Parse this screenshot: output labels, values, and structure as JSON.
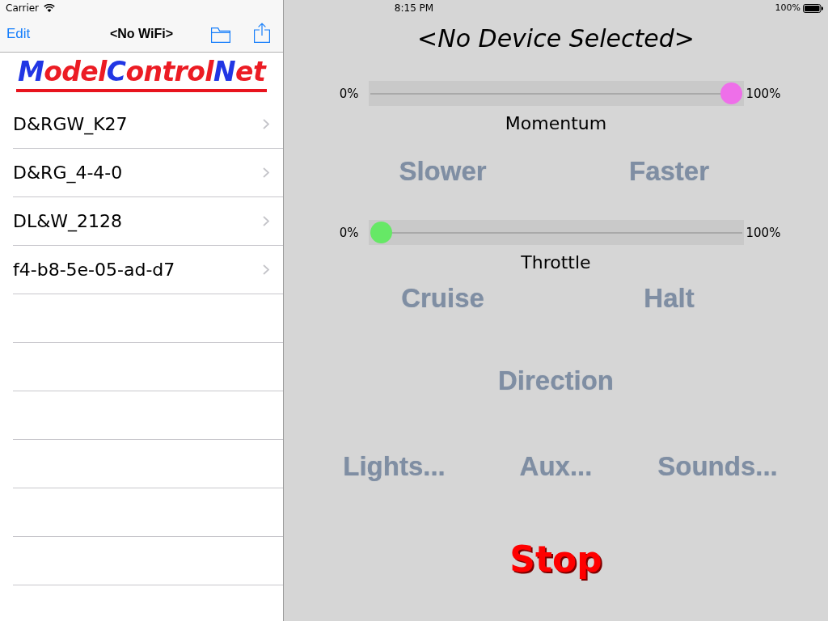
{
  "status_bar": {
    "carrier": "Carrier",
    "time": "8:15 PM",
    "battery": "100%"
  },
  "sidebar": {
    "nav_bar": {
      "edit_button": "Edit",
      "title": "<No WiFi>"
    },
    "logo": "ModelControlNet",
    "devices": [
      {
        "name": "D&RGW_K27",
        "selected": false
      },
      {
        "name": "D&RG_4-4-0",
        "selected": false
      },
      {
        "name": "DL&W_2128",
        "selected": false
      },
      {
        "name": "f4-b8-5e-05-ad-d7",
        "selected": false
      }
    ]
  },
  "panel": {
    "title": "<No Device Selected>",
    "controls": [
      {
        "kind": "slider",
        "min_label": "0%",
        "max_label": "100%",
        "level": 1,
        "color": "#ee6fe9",
        "label": "Momentum"
      },
      {
        "kind": "buttons",
        "buttons": [
          {
            "label": "Slower",
            "disabled": true
          },
          {
            "label": "Faster",
            "disabled": true
          }
        ]
      },
      {
        "kind": "slider",
        "min_label": "0%",
        "max_label": "100%",
        "level": 0,
        "color": "#66e866",
        "label": "Throttle"
      },
      {
        "kind": "buttons",
        "buttons": [
          {
            "label": "Cruise",
            "disabled": true
          },
          {
            "label": "Halt",
            "disabled": true
          }
        ]
      },
      {
        "kind": "buttons",
        "buttons": [
          {
            "label": "Direction",
            "disabled": true
          }
        ]
      },
      {
        "kind": "buttons",
        "buttons": [
          {
            "label": "Lights...",
            "disabled": true
          },
          {
            "label": "Aux...",
            "disabled": true
          },
          {
            "label": "Sounds...",
            "disabled": true
          }
        ]
      },
      {
        "kind": "stop",
        "label": "Stop"
      }
    ]
  }
}
